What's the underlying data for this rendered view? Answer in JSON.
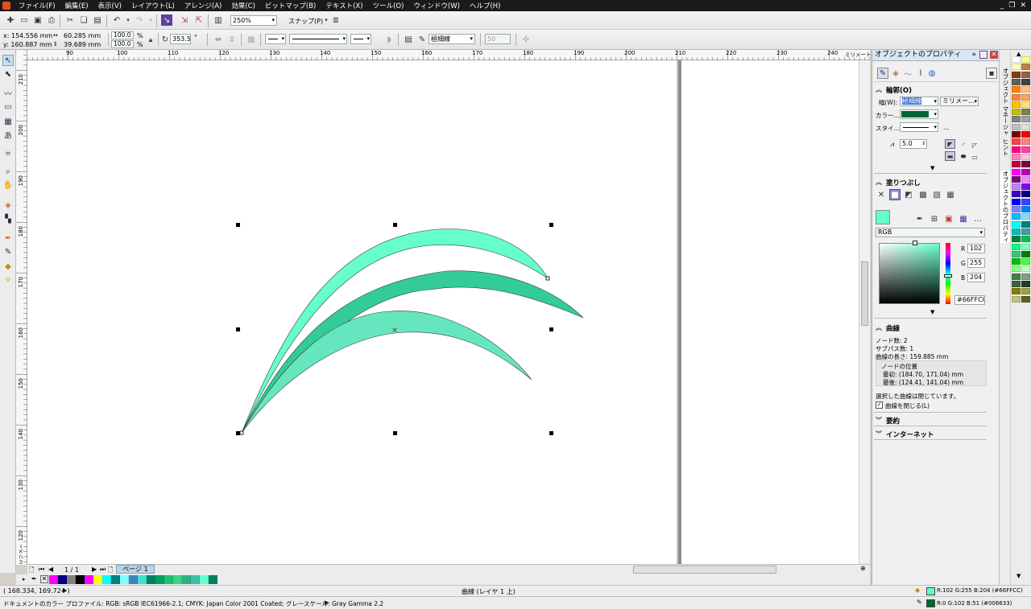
{
  "menu": [
    "ファイル(F)",
    "編集(E)",
    "表示(V)",
    "レイアウト(L)",
    "アレンジ(A)",
    "効果(C)",
    "ビットマップ(B)",
    "テキスト(X)",
    "ツール(O)",
    "ウィンドウ(W)",
    "ヘルプ(H)"
  ],
  "toolbar": {
    "zoom": "250%",
    "snap": "スナップ(P)"
  },
  "propbar": {
    "x": "x: 154.556 mm",
    "y": "y: 160.887 mm",
    "w": "60.285 mm",
    "h": "39.689 mm",
    "scale_x": "100.0",
    "scale_y": "100.0",
    "pct": "%",
    "angle": "353.5",
    "deg": "°",
    "outline_width": "極細線",
    "num": "50"
  },
  "ruler": {
    "h_ticks": [
      "90",
      "100",
      "110",
      "120",
      "130",
      "140",
      "150",
      "160",
      "170",
      "180",
      "190",
      "200",
      "210",
      "220",
      "230",
      "240"
    ],
    "h_unit": "ミリメートル",
    "v_ticks": [
      "210",
      "200",
      "190",
      "180",
      "170",
      "160",
      "150",
      "140",
      "130",
      "120"
    ],
    "v_unit": "ミリメートル"
  },
  "page_nav": {
    "count": "1 / 1",
    "tab": "ページ 1"
  },
  "status": {
    "coords": "( 168.334, 169.724 )",
    "object": "曲線 (レイヤ 1 上)",
    "fill_info": "R:102 G:255 B:204 (#66FFCC)",
    "outline_info": "R:0 G:102 B:51 (#006633)",
    "profile": "ドキュメントのカラー プロファイル: RGB: sRGB IEC61966-2.1; CMYK: Japan Color 2001 Coated; グレースケール: Gray Gamma 2.2"
  },
  "docker": {
    "title": "オブジェクトのプロパティ",
    "outline": {
      "header": "輪郭(O)",
      "width_label": "幅(W):",
      "width_value": "極細線",
      "unit": "ミリメー...",
      "color_label": "カラー...",
      "style_label": "スタイ...",
      "miter": "5.0"
    },
    "fill": {
      "header": "塗りつぶし",
      "model": "RGB",
      "r_label": "R",
      "g_label": "G",
      "b_label": "B",
      "r": "102",
      "g": "255",
      "b": "204",
      "hex": "#66FFCC"
    },
    "curve": {
      "header": "曲線",
      "nodes": "ノード数:    2",
      "subpaths": "サブパス数:  1",
      "length": "曲線の長さ: 159.885 mm",
      "node_pos_label": "ノードの位置",
      "first": "最初:  (184.70, 171.04) mm",
      "last": "最後:  (124.41, 141.04) mm",
      "closed_msg": "選択した曲線は閉じています。",
      "close_check": "曲線を閉じる(L)"
    },
    "summary": "要約",
    "internet": "インターネット"
  },
  "docker_tabs": [
    "オブジェクト マネージャ",
    "ヒント",
    "オブジェクトのプロパティ"
  ],
  "colors": {
    "fill": "#66FFCC",
    "fill2": "#33CC99",
    "fill3": "#66E6BF",
    "outline": "#006633",
    "menubar": "#1a1a1a"
  },
  "swatches_bottom": [
    "#ff00ff",
    "#000080",
    "#808080",
    "#000000",
    "#ff00ff",
    "#ffff00",
    "#00ffff",
    "#008080",
    "#80ffff",
    "#4080c0",
    "#40e0d0",
    "#008060",
    "#00a060",
    "#20c070",
    "#40d080",
    "#30b080",
    "#40c0a0",
    "#66ffcc",
    "#008060"
  ],
  "palette": [
    "#ffffff",
    "#ffff80",
    "#ffffc0",
    "#c08040",
    "#804000",
    "#a06040",
    "#606060",
    "#404040",
    "#ff8000",
    "#ffc080",
    "#ff8040",
    "#ffa060",
    "#ffc000",
    "#ffe080",
    "#c0c000",
    "#808040",
    "#808080",
    "#a0a0a0",
    "#c0c0c0",
    "#e0e0e0",
    "#800000",
    "#ff0000",
    "#ff4040",
    "#ff8080",
    "#ff0080",
    "#ff40a0",
    "#ff80c0",
    "#ffc0e0",
    "#c00040",
    "#800040",
    "#ff00ff",
    "#c000c0",
    "#800080",
    "#ff80ff",
    "#c080ff",
    "#8000ff",
    "#4000c0",
    "#000080",
    "#0000ff",
    "#4040ff",
    "#8080ff",
    "#0080ff",
    "#00c0ff",
    "#80e0ff",
    "#00ffff",
    "#008080",
    "#00c0c0",
    "#40a0a0",
    "#008040",
    "#00c060",
    "#00ff80",
    "#80ffc0",
    "#40c080",
    "#008000",
    "#00c000",
    "#40ff40",
    "#80ff80",
    "#c0ffc0",
    "#408040",
    "#80a080",
    "#406040",
    "#204020",
    "#808000",
    "#a0a040",
    "#c0c080",
    "#606020"
  ]
}
